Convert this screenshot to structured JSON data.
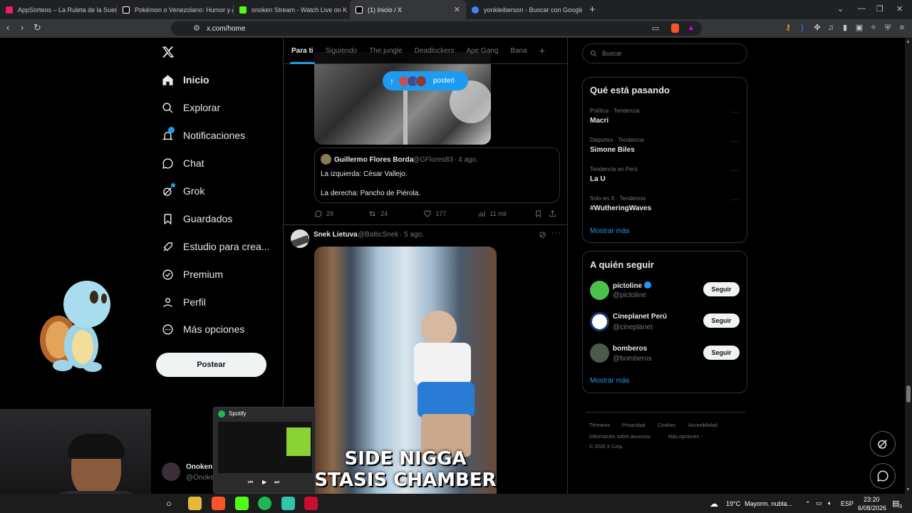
{
  "browser": {
    "tabs": [
      {
        "title": "AppSorteos – La Ruleta de la Suerte",
        "color": "#e91e63"
      },
      {
        "title": "Pokémon o Venezolano: Humor y Ar",
        "color": "#ffffff"
      },
      {
        "title": "onoken Stream - Watch Live on K",
        "color": "#53fc18"
      },
      {
        "title": "(1) Inicio / X",
        "color": "#ffffff",
        "active": true
      },
      {
        "title": "yonkleiberson - Buscar con Google",
        "color": "#4285f4"
      }
    ],
    "url": "x.com/home"
  },
  "sidebar": {
    "items": [
      {
        "label": "Inicio",
        "icon": "home-icon"
      },
      {
        "label": "Explorar",
        "icon": "search-icon"
      },
      {
        "label": "Notificaciones",
        "icon": "bell-icon"
      },
      {
        "label": "Chat",
        "icon": "chat-icon"
      },
      {
        "label": "Grok",
        "icon": "grok-icon"
      },
      {
        "label": "Guardados",
        "icon": "bookmark-icon"
      },
      {
        "label": "Estudio para crea...",
        "icon": "rocket-icon"
      },
      {
        "label": "Premium",
        "icon": "premium-icon"
      },
      {
        "label": "Perfil",
        "icon": "person-icon"
      },
      {
        "label": "Más opciones",
        "icon": "more-circle-icon"
      }
    ],
    "post_label": "Postear",
    "account_name": "Onoken",
    "account_handle": "@Onoke"
  },
  "feed": {
    "tabs": [
      "Para ti",
      "Siguiendo",
      "The jungle",
      "Deadlockers",
      "Ape Gang",
      "Bana"
    ],
    "new_posts_label": "posteó",
    "quoted": {
      "name": "Guillermo Flores Borda",
      "handle": "@GFlores83",
      "date": "· 4 ago.",
      "line1": "La izquierda: César Vallejo.",
      "line2": "La derecha: Pancho de Piérola."
    },
    "stats": {
      "replies": "29",
      "reposts": "24",
      "likes": "177",
      "views": "11 mil"
    },
    "post2": {
      "name": "Snek Lietuva",
      "handle": "@BalticSnek",
      "date": "· 5 ago.",
      "caption_line1": "SIDE NIGGA",
      "caption_line2": "STASIS CHAMBER"
    }
  },
  "right": {
    "search_placeholder": "Buscar",
    "trends_title": "Qué está pasando",
    "trends": [
      {
        "meta": "Política · Tendencia",
        "name": "Macri"
      },
      {
        "meta": "Deportes · Tendencia",
        "name": "Simone Biles"
      },
      {
        "meta": "Tendencia en Perú",
        "name": "La U"
      },
      {
        "meta": "Solo en X · Tendencia",
        "name": "#WutheringWaves"
      }
    ],
    "show_more": "Mostrar más",
    "follow_title": "A quién seguir",
    "follow": [
      {
        "name": "pictoline",
        "handle": "@pictoline",
        "verified": true
      },
      {
        "name": "Cineplanet Perú",
        "handle": "@cineplanet"
      },
      {
        "name": "bomberos",
        "handle": "@bomberos"
      }
    ],
    "follow_btn": "Seguir",
    "show_more2": "Mostrar más",
    "footer": [
      "Términos",
      "Privacidad",
      "Cookies",
      "Accesibilidad",
      "Información sobre anuncios",
      "Más opciones ···",
      "© 2026 X Corp."
    ]
  },
  "spotify": {
    "title": "Spotify"
  },
  "taskbar": {
    "weather": "19°C",
    "weather_desc": "Mayorm. nubla...",
    "lang": "ESP",
    "time": "23:20",
    "date": "6/08/2026",
    "notif_count": "3"
  }
}
